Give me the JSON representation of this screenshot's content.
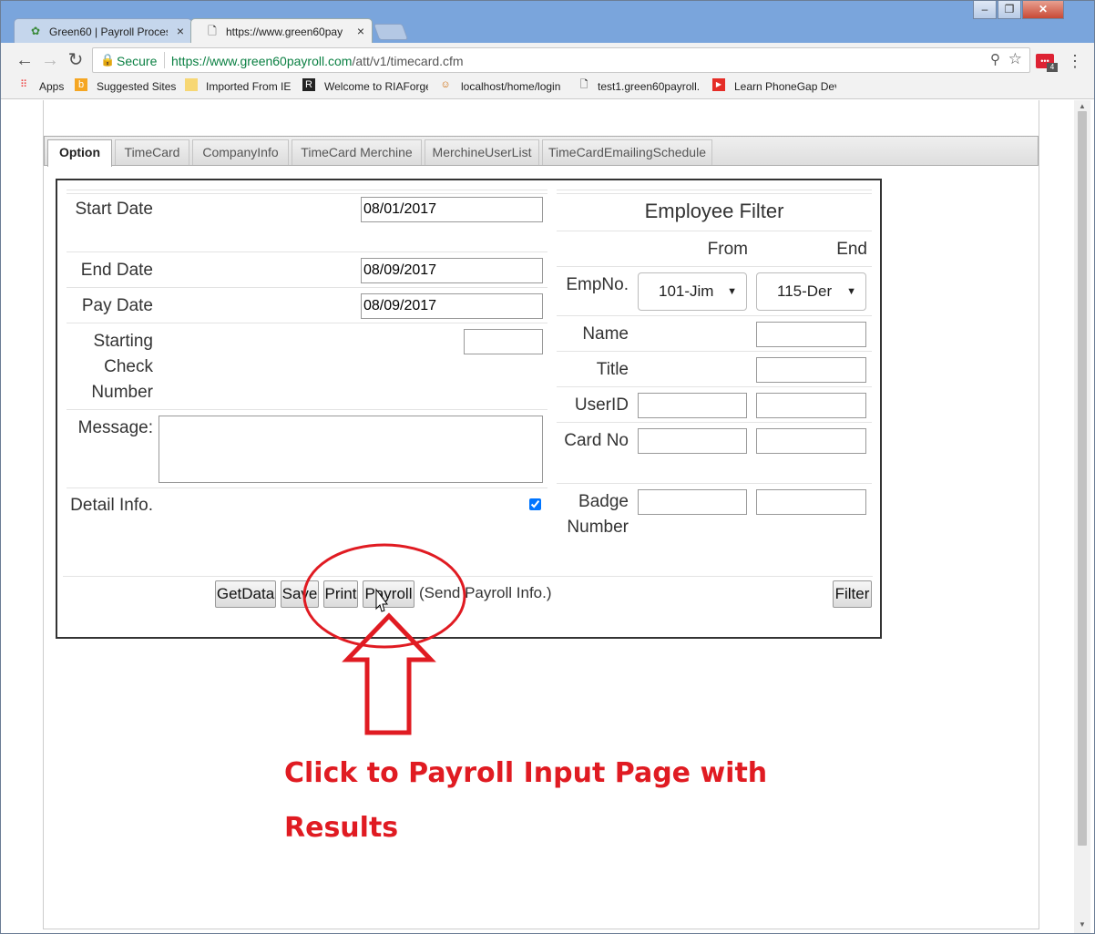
{
  "browser": {
    "tabs": [
      {
        "title": "Green60 | Payroll Process",
        "close": "×"
      },
      {
        "title": "https://www.green60pay",
        "close": "×"
      }
    ],
    "window_buttons": {
      "minimize": "‒",
      "maximize": "❐",
      "close": "✕"
    },
    "nav": {
      "back": "←",
      "forward": "→",
      "reload": "↻"
    },
    "secure_label": "Secure",
    "url_host": "https://www.green60payroll.com",
    "url_path": "/att/v1/timecard.cfm",
    "extension_badge": "4",
    "bookmarks": [
      {
        "label": "Apps",
        "icon": "apps-grid-icon"
      },
      {
        "label": "Suggested Sites",
        "icon": "bing-icon"
      },
      {
        "label": "Imported From IE",
        "icon": "folder-icon"
      },
      {
        "label": "Welcome to RIAForge",
        "icon": "riaforge-icon"
      },
      {
        "label": "localhost/home/login",
        "icon": "people-icon"
      },
      {
        "label": "test1.green60payroll.",
        "icon": "page-icon"
      },
      {
        "label": "Learn PhoneGap Dev",
        "icon": "youtube-icon"
      }
    ]
  },
  "app_tabs": [
    {
      "label": "Option",
      "selected": true
    },
    {
      "label": "TimeCard"
    },
    {
      "label": "CompanyInfo"
    },
    {
      "label": "TimeCard Merchine"
    },
    {
      "label": "MerchineUserList"
    },
    {
      "label": "TimeCardEmailingSchedule"
    }
  ],
  "form": {
    "start_date_label": "Start Date",
    "start_date_value": "08/01/2017",
    "end_date_label": "End Date",
    "end_date_value": "08/09/2017",
    "pay_date_label": "Pay Date",
    "pay_date_value": "08/09/2017",
    "starting_check_label": "Starting Check Number",
    "starting_check_value": "",
    "message_label": "Message:",
    "message_value": "",
    "detail_info_label": "Detail Info.",
    "detail_info_checked": true
  },
  "filter": {
    "title": "Employee Filter",
    "from_label": "From",
    "end_label": "End",
    "empno_label": "EmpNo.",
    "empno_from": "101-Jim",
    "empno_end": "115-Der",
    "name_label": "Name",
    "title_label": "Title",
    "userid_label": "UserID",
    "cardno_label": "Card No",
    "badge_label": "Badge Number"
  },
  "actions": {
    "getdata": "GetData",
    "save": "Save",
    "print": "Print",
    "payroll": "Payroll",
    "payroll_note": "(Send Payroll Info.)",
    "filter": "Filter"
  },
  "annotation": {
    "line1": "Click to Payroll Input Page with",
    "line2": "Results",
    "color": "#e01b22"
  }
}
